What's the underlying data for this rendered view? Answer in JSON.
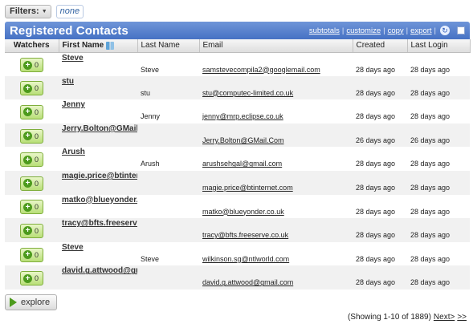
{
  "filters": {
    "label": "Filters:",
    "value": "none"
  },
  "panel": {
    "title": "Registered Contacts",
    "actions": [
      "subtotals",
      "customize",
      "copy",
      "export"
    ]
  },
  "columns": {
    "watchers": "Watchers",
    "first_name": "First Name",
    "last_name": "Last Name",
    "email": "Email",
    "created": "Created",
    "last_login": "Last Login"
  },
  "rows": [
    {
      "watchers": "0",
      "display": "Steve",
      "first": "Steve",
      "last": "",
      "email": "samstevecompila2@googlemail.com",
      "created": "28 days ago",
      "last_login": "28 days ago"
    },
    {
      "watchers": "0",
      "display": "stu",
      "first": "stu",
      "last": "",
      "email": "stu@computec-limited.co.uk",
      "created": "28 days ago",
      "last_login": "28 days ago"
    },
    {
      "watchers": "0",
      "display": "Jenny",
      "first": "Jenny",
      "last": "",
      "email": "jenny@mrp.eclipse.co.uk",
      "created": "28 days ago",
      "last_login": "28 days ago"
    },
    {
      "watchers": "0",
      "display": "Jerry.Bolton@GMail.Com",
      "first": "",
      "last": "",
      "email": "Jerry.Bolton@GMail.Com",
      "created": "26 days ago",
      "last_login": "26 days ago"
    },
    {
      "watchers": "0",
      "display": "Arush",
      "first": "Arush",
      "last": "",
      "email": "arushsehgal@gmail.com",
      "created": "28 days ago",
      "last_login": "28 days ago"
    },
    {
      "watchers": "0",
      "display": "magie.price@btinternet.com",
      "first": "",
      "last": "",
      "email": "magie.price@btinternet.com",
      "created": "28 days ago",
      "last_login": "28 days ago"
    },
    {
      "watchers": "0",
      "display": "matko@blueyonder.co.uk",
      "first": "",
      "last": "",
      "email": "matko@blueyonder.co.uk",
      "created": "28 days ago",
      "last_login": "28 days ago"
    },
    {
      "watchers": "0",
      "display": "tracy@bfts.freeserve.co.uk",
      "first": "",
      "last": "",
      "email": "tracy@bfts.freeserve.co.uk",
      "created": "28 days ago",
      "last_login": "28 days ago"
    },
    {
      "watchers": "0",
      "display": "Steve",
      "first": "Steve",
      "last": "",
      "email": "wilkinson.sg@ntlworld.com",
      "created": "28 days ago",
      "last_login": "28 days ago"
    },
    {
      "watchers": "0",
      "display": "david.g.attwood@gmail.com",
      "first": "",
      "last": "",
      "email": "david.g.attwood@gmail.com",
      "created": "28 days ago",
      "last_login": "28 days ago"
    }
  ],
  "explore_label": "explore",
  "pager": {
    "summary": "(Showing 1-10 of 1889)",
    "next": "Next>",
    "last": ">>"
  }
}
